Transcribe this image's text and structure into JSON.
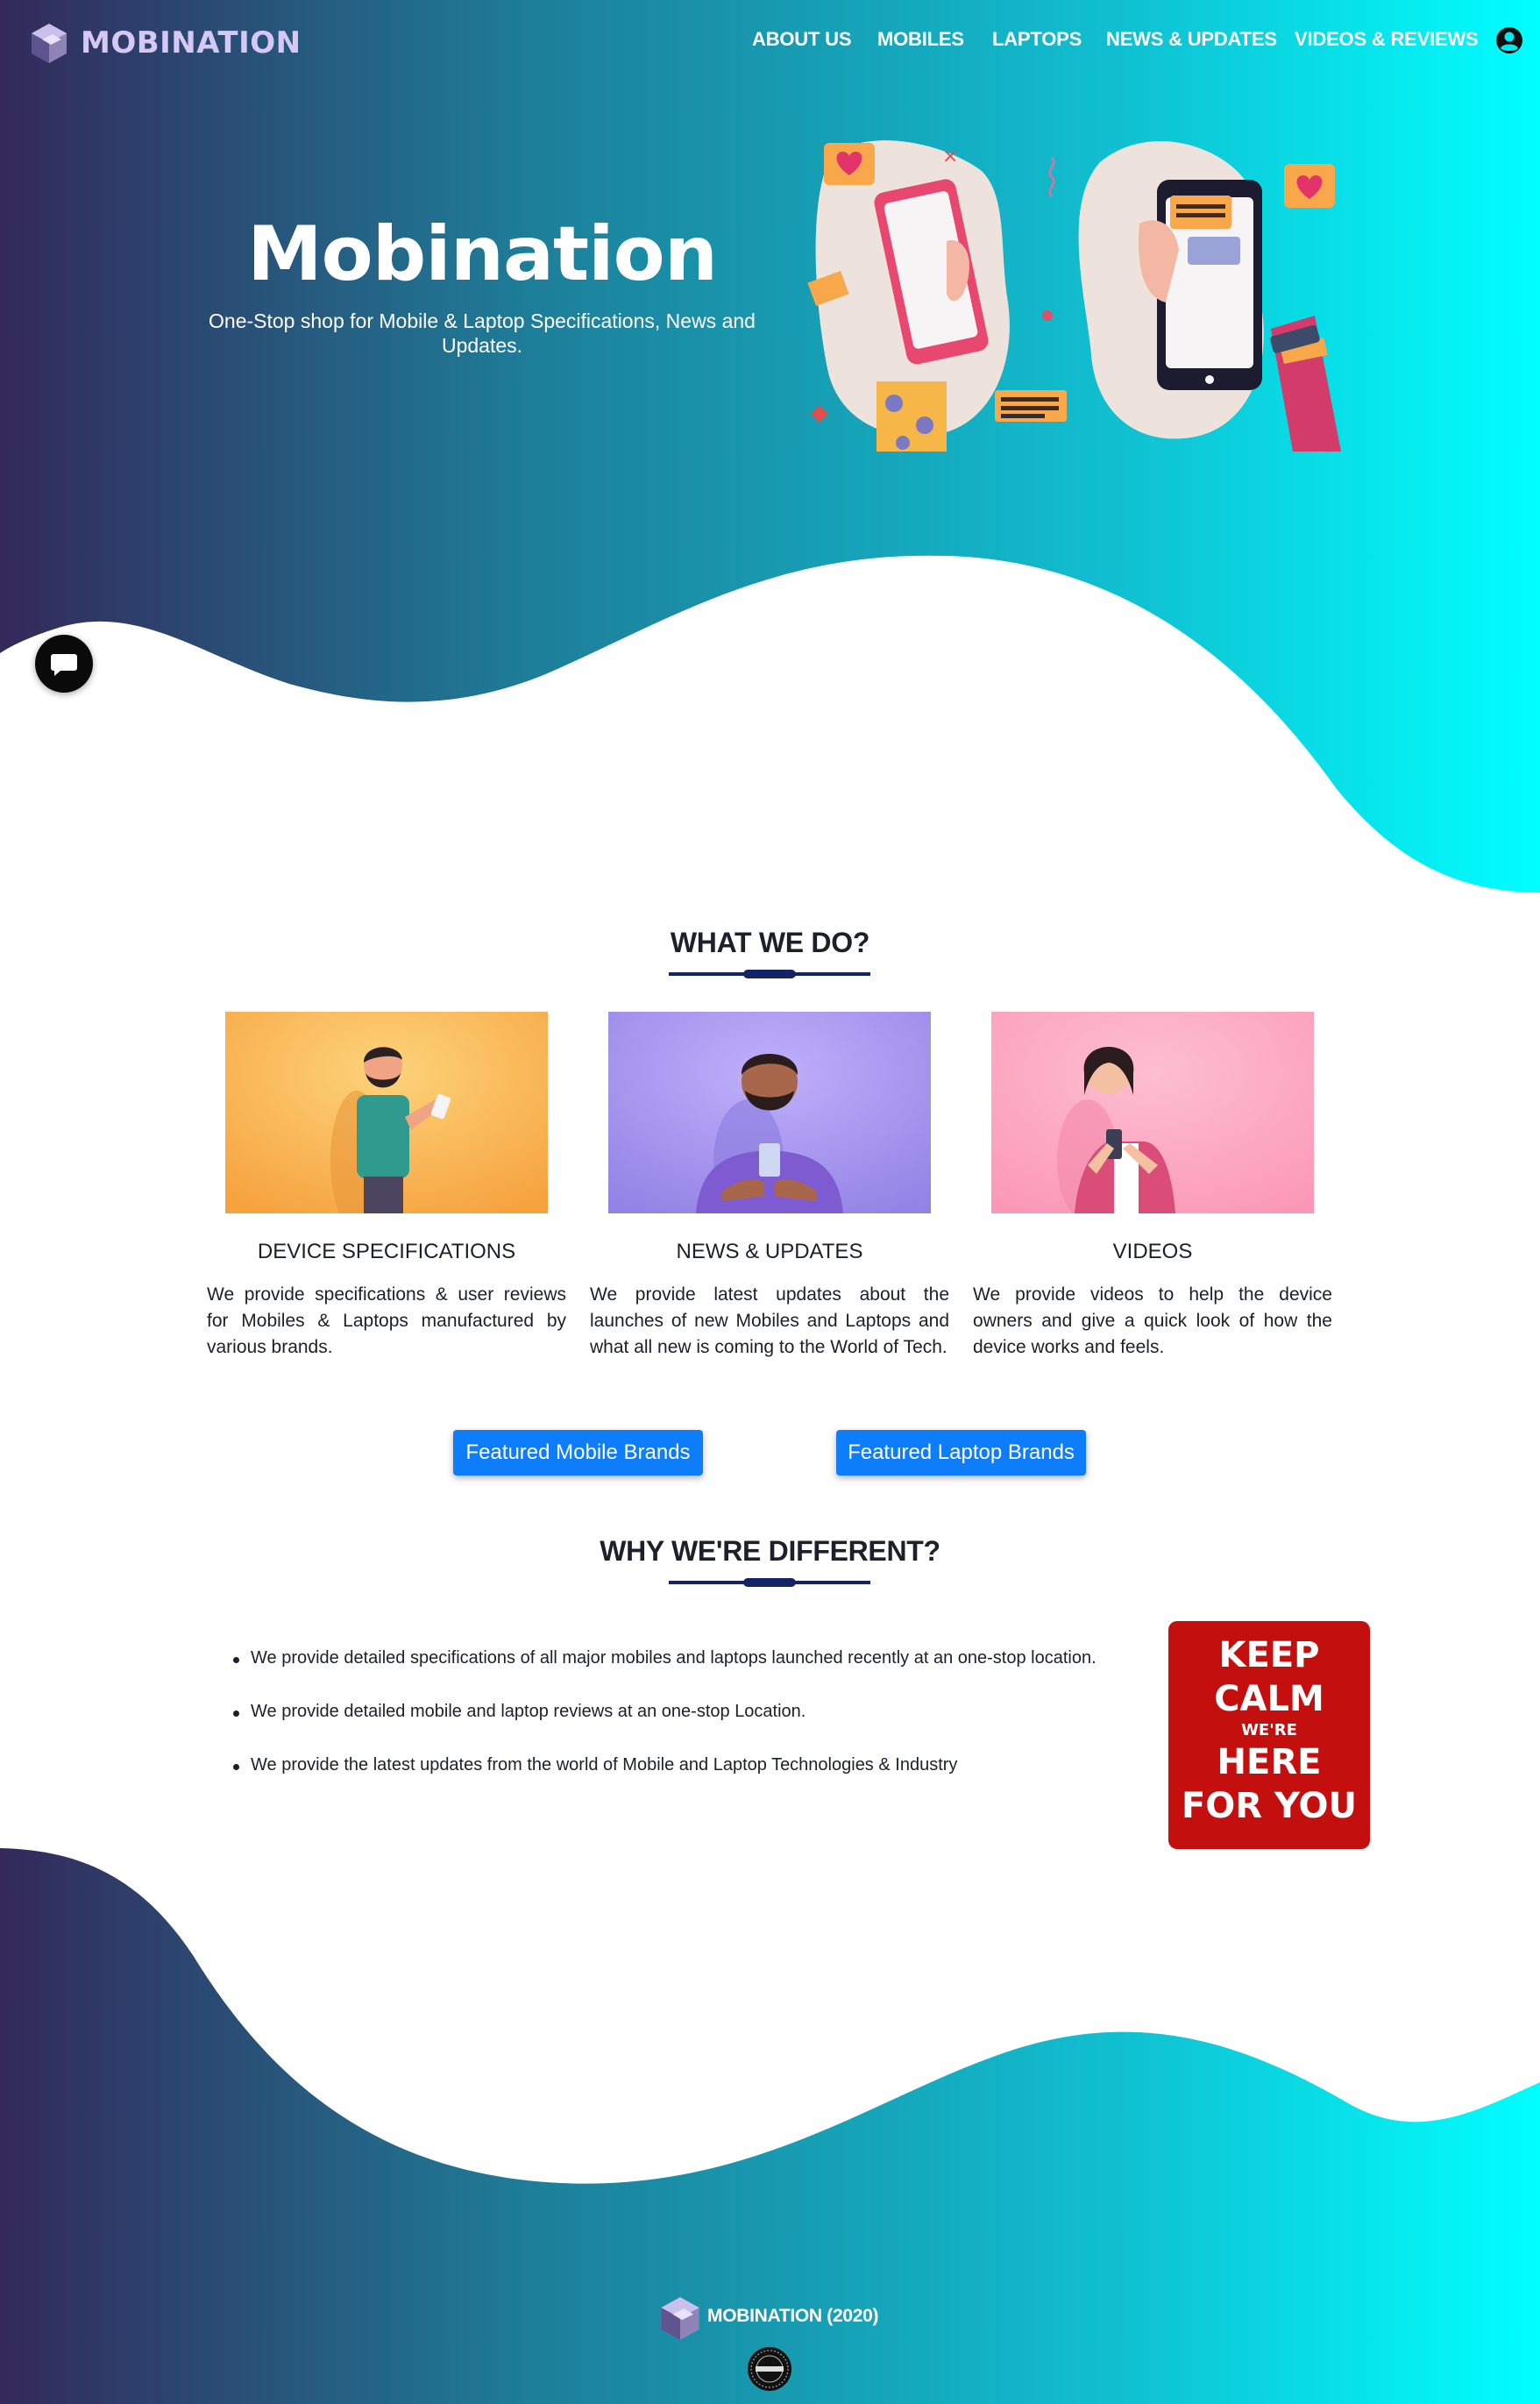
{
  "brand": {
    "name": "MOBINATION"
  },
  "nav": {
    "items": [
      "ABOUT US",
      "MOBILES",
      "LAPTOPS",
      "NEWS & UPDATES",
      "VIDEOS & REVIEWS"
    ]
  },
  "hero": {
    "title": "Mobination",
    "subtitle": "One-Stop shop for Mobile & Laptop Specifications, News and Updates."
  },
  "what_we_do": {
    "title": "WHAT WE DO?",
    "cards": [
      {
        "title": "DEVICE SPECIFICATIONS",
        "text": "We provide specifications & user reviews for Mobiles & Laptops manufactured by various brands.",
        "bg": "#f7ac45"
      },
      {
        "title": "NEWS & UPDATES",
        "text": "We provide latest updates about the launches of new Mobiles and Laptops and what all new is coming to the World of Tech.",
        "bg": "#a598f0"
      },
      {
        "title": "VIDEOS",
        "text": "We provide videos to help the device owners and give a quick look of how the device works and feels.",
        "bg": "#fba2be"
      }
    ]
  },
  "buttons": {
    "mobile_brands": "Featured Mobile Brands",
    "laptop_brands": "Featured Laptop Brands"
  },
  "why_different": {
    "title": "WHY WE'RE DIFFERENT?",
    "items": [
      "We provide detailed specifications of all major mobiles and laptops launched recently at an one-stop location.",
      "We provide detailed mobile and laptop reviews at an one-stop Location.",
      "We provide the latest updates from the world of Mobile and Laptop Technologies & Industry"
    ]
  },
  "keep_calm": {
    "line1": "KEEP",
    "line2": "CALM",
    "line3": "WE'RE",
    "line4": "HERE",
    "line5": "FOR YOU"
  },
  "footer": {
    "text": "MOBINATION (2020)"
  },
  "colors": {
    "gradient_start": "#33295a",
    "gradient_mid": "#1a8fa8",
    "gradient_end": "#00ffff",
    "accent_blue": "#0d7dfa",
    "underline": "#142366",
    "keep_calm_red": "#c40f0f"
  }
}
